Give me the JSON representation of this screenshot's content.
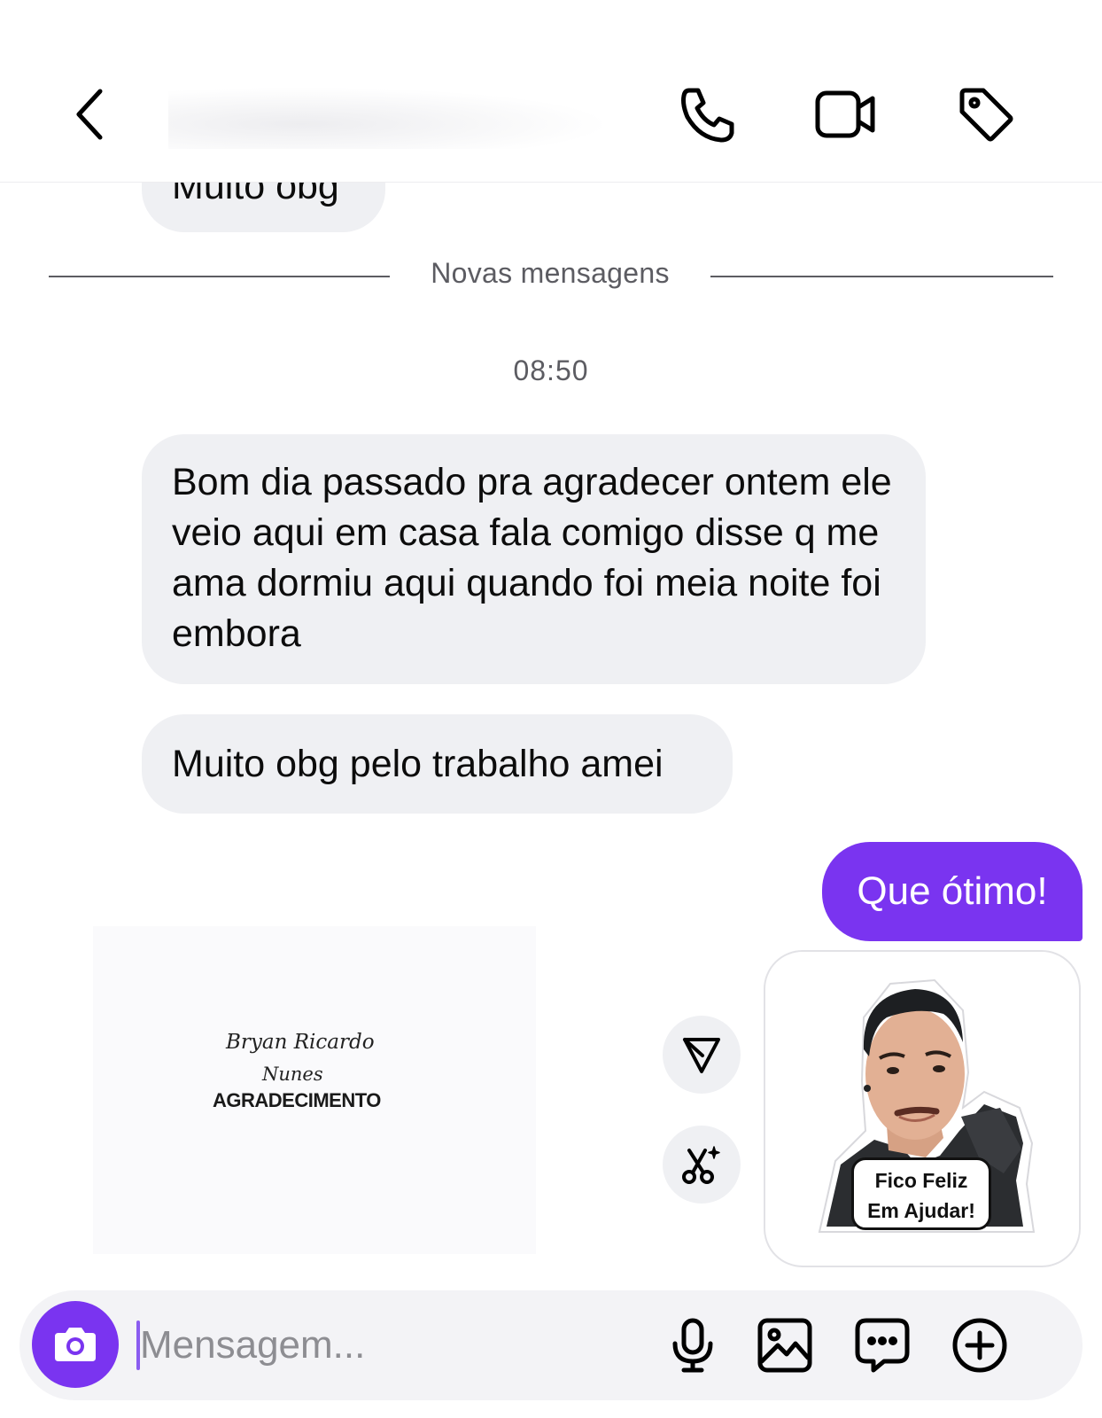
{
  "header": {
    "back_icon": "chevron-left-icon",
    "actions": [
      "phone-icon",
      "video-camera-icon",
      "tag-icon"
    ]
  },
  "messages": {
    "partial_previous": "Muito obg",
    "divider_label": "Novas mensagens",
    "timestamp": "08:50",
    "incoming": [
      {
        "text": "Bom dia passado pra agradecer ontem ele veio aqui em casa fala comigo disse q me ama dormiu aqui quando foi meia noite foi embora"
      },
      {
        "text": "Muito obg pelo trabalho amei"
      }
    ],
    "outgoing": {
      "text": "Que ótimo!"
    }
  },
  "card": {
    "signature_line1": "Bryan Ricardo",
    "signature_line2": "Nunes",
    "title": "AGRADECIMENTO"
  },
  "quick_actions": [
    "send-icon",
    "ai-scissors-icon"
  ],
  "sticker": {
    "line1": "Fico Feliz",
    "line2": "Em Ajudar!"
  },
  "composer": {
    "placeholder": "Mensagem...",
    "value": "",
    "tools": [
      "camera-icon",
      "microphone-icon",
      "gallery-icon",
      "sticker-chat-icon",
      "add-icon"
    ]
  },
  "colors": {
    "accent": "#7a34f0",
    "incoming_bubble": "#eff0f3",
    "secondary_text": "#5c5c62",
    "background": "#ffffff"
  }
}
